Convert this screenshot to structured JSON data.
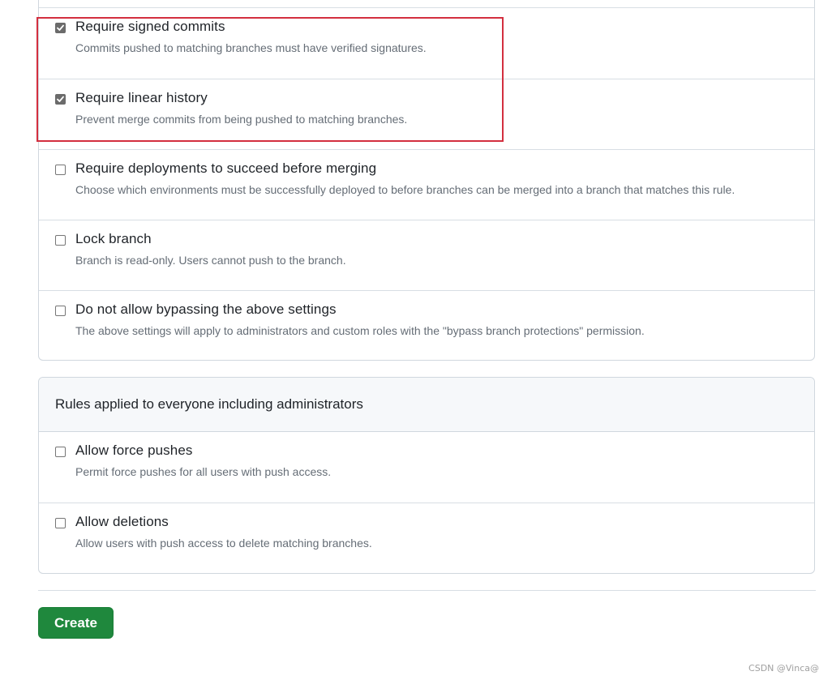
{
  "protection_options": [
    {
      "label": "Require signed commits",
      "description": "Commits pushed to matching branches must have verified signatures.",
      "checked": true
    },
    {
      "label": "Require linear history",
      "description": "Prevent merge commits from being pushed to matching branches.",
      "checked": true
    },
    {
      "label": "Require deployments to succeed before merging",
      "description": "Choose which environments must be successfully deployed to before branches can be merged into a branch that matches this rule.",
      "checked": false
    },
    {
      "label": "Lock branch",
      "description": "Branch is read-only. Users cannot push to the branch.",
      "checked": false
    },
    {
      "label": "Do not allow bypassing the above settings",
      "description": "The above settings will apply to administrators and custom roles with the \"bypass branch protections\" permission.",
      "checked": false
    }
  ],
  "everyone_section": {
    "title": "Rules applied to everyone including administrators",
    "options": [
      {
        "label": "Allow force pushes",
        "description": "Permit force pushes for all users with push access.",
        "checked": false
      },
      {
        "label": "Allow deletions",
        "description": "Allow users with push access to delete matching branches.",
        "checked": false
      }
    ]
  },
  "actions": {
    "create_label": "Create"
  },
  "watermark": "CSDN @Vinca@",
  "colors": {
    "primary_button": "#1f883d",
    "highlight_border": "#d32f3f",
    "border": "#d0d7de",
    "muted_text": "#656d76"
  }
}
